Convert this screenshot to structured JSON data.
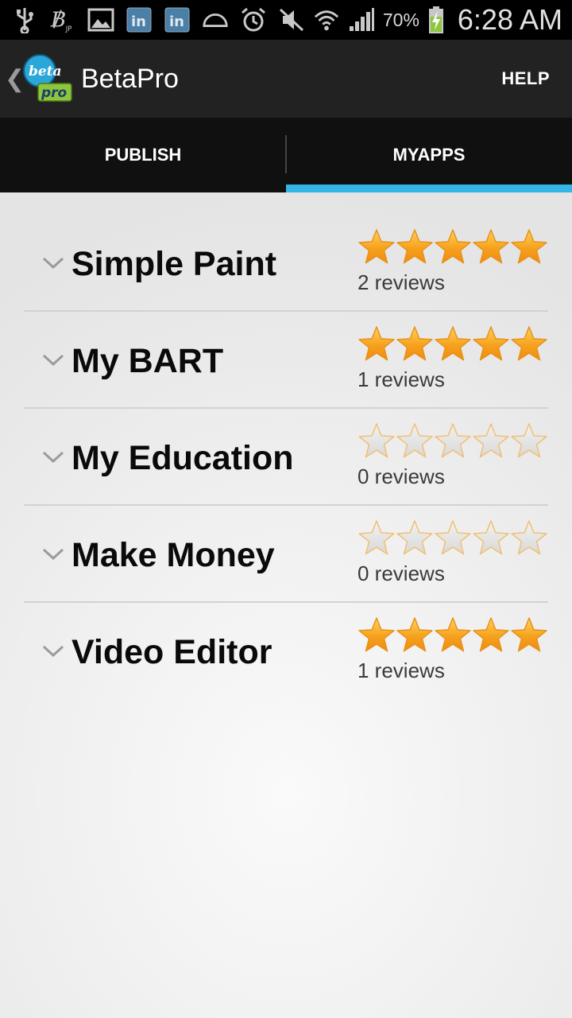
{
  "status_bar": {
    "battery_pct": "70%",
    "time": "6:28 AM",
    "icons": [
      "usb-icon",
      "beta-jp-icon",
      "image-icon",
      "linkedin-icon",
      "linkedin-icon",
      "half-circle-icon",
      "alarm-icon",
      "mute-icon",
      "wifi-icon",
      "signal-icon",
      "battery-icon"
    ]
  },
  "action_bar": {
    "title": "BetaPro",
    "logo_top": "beta",
    "logo_bottom": "pro",
    "help_label": "HELP"
  },
  "tabs": [
    {
      "label": "PUBLISH",
      "selected": false
    },
    {
      "label": "MYAPPS",
      "selected": true
    }
  ],
  "colors": {
    "accent": "#33b5e5",
    "star_filled": "#f6a21e",
    "star_empty": "#d8d8d8"
  },
  "apps": [
    {
      "name": "Simple Paint",
      "rating": 5,
      "reviews": "2 reviews"
    },
    {
      "name": "My BART",
      "rating": 5,
      "reviews": "1 reviews"
    },
    {
      "name": "My Education",
      "rating": 0,
      "reviews": "0 reviews"
    },
    {
      "name": "Make Money",
      "rating": 0,
      "reviews": "0 reviews"
    },
    {
      "name": "Video Editor",
      "rating": 5,
      "reviews": "1 reviews"
    }
  ]
}
